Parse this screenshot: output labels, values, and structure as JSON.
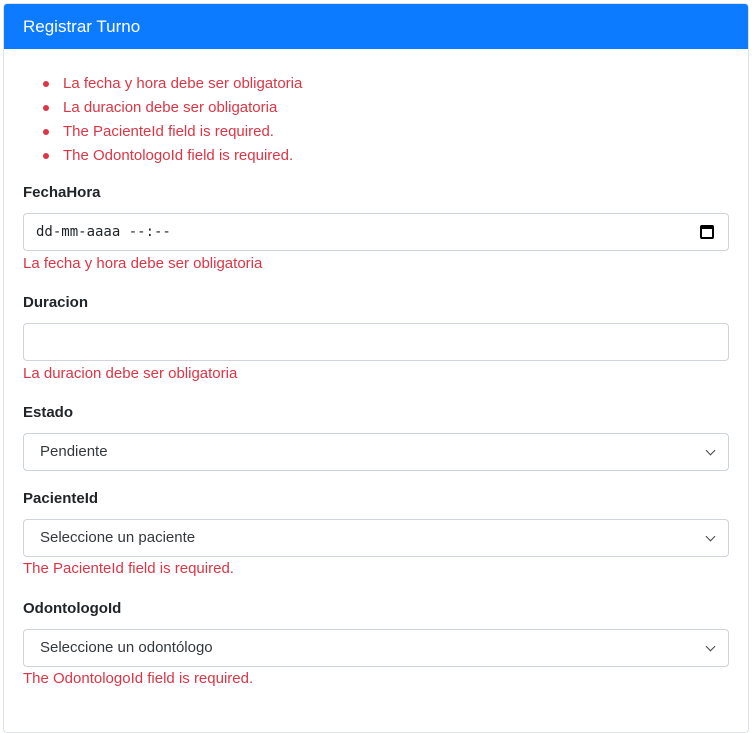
{
  "card": {
    "title": "Registrar Turno"
  },
  "summary": [
    "La fecha y hora debe ser obligatoria",
    "La duracion debe ser obligatoria",
    "The PacienteId field is required.",
    "The OdontologoId field is required."
  ],
  "fields": {
    "fechahora": {
      "label": "FechaHora",
      "placeholder": "dd-mm-aaaa --:--",
      "error": "La fecha y hora debe ser obligatoria"
    },
    "duracion": {
      "label": "Duracion",
      "value": "",
      "error": "La duracion debe ser obligatoria"
    },
    "estado": {
      "label": "Estado",
      "selected": "Pendiente"
    },
    "pacienteid": {
      "label": "PacienteId",
      "selected": "Seleccione un paciente",
      "error": "The PacienteId field is required."
    },
    "odontologoid": {
      "label": "OdontologoId",
      "selected": "Seleccione un odontólogo",
      "error": "The OdontologoId field is required."
    }
  },
  "colors": {
    "header": "#0d7bff",
    "error": "#dc3545",
    "border": "#ced4da"
  }
}
